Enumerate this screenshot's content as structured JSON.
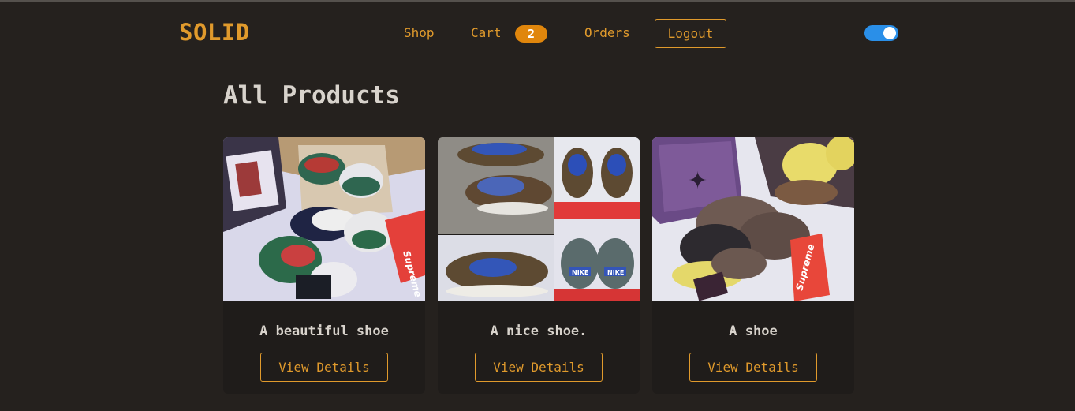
{
  "brand": "SOLID",
  "nav": {
    "shop": "Shop",
    "cart": "Cart",
    "cart_count": "2",
    "orders": "Orders",
    "logout": "Logout"
  },
  "theme_toggle": {
    "on": true,
    "color": "#2a8fe8"
  },
  "page": {
    "title": "All Products"
  },
  "products": [
    {
      "title": "A beautiful shoe",
      "button": "View Details",
      "image_label": "Supreme"
    },
    {
      "title": "A nice shoe.",
      "button": "View Details",
      "image_label": "NIKE"
    },
    {
      "title": "A shoe",
      "button": "View Details",
      "image_label": "Supreme"
    }
  ],
  "colors": {
    "accent": "#e09a2c",
    "background": "#25211e",
    "card": "#1f1c1a",
    "badge": "#e0860c"
  }
}
